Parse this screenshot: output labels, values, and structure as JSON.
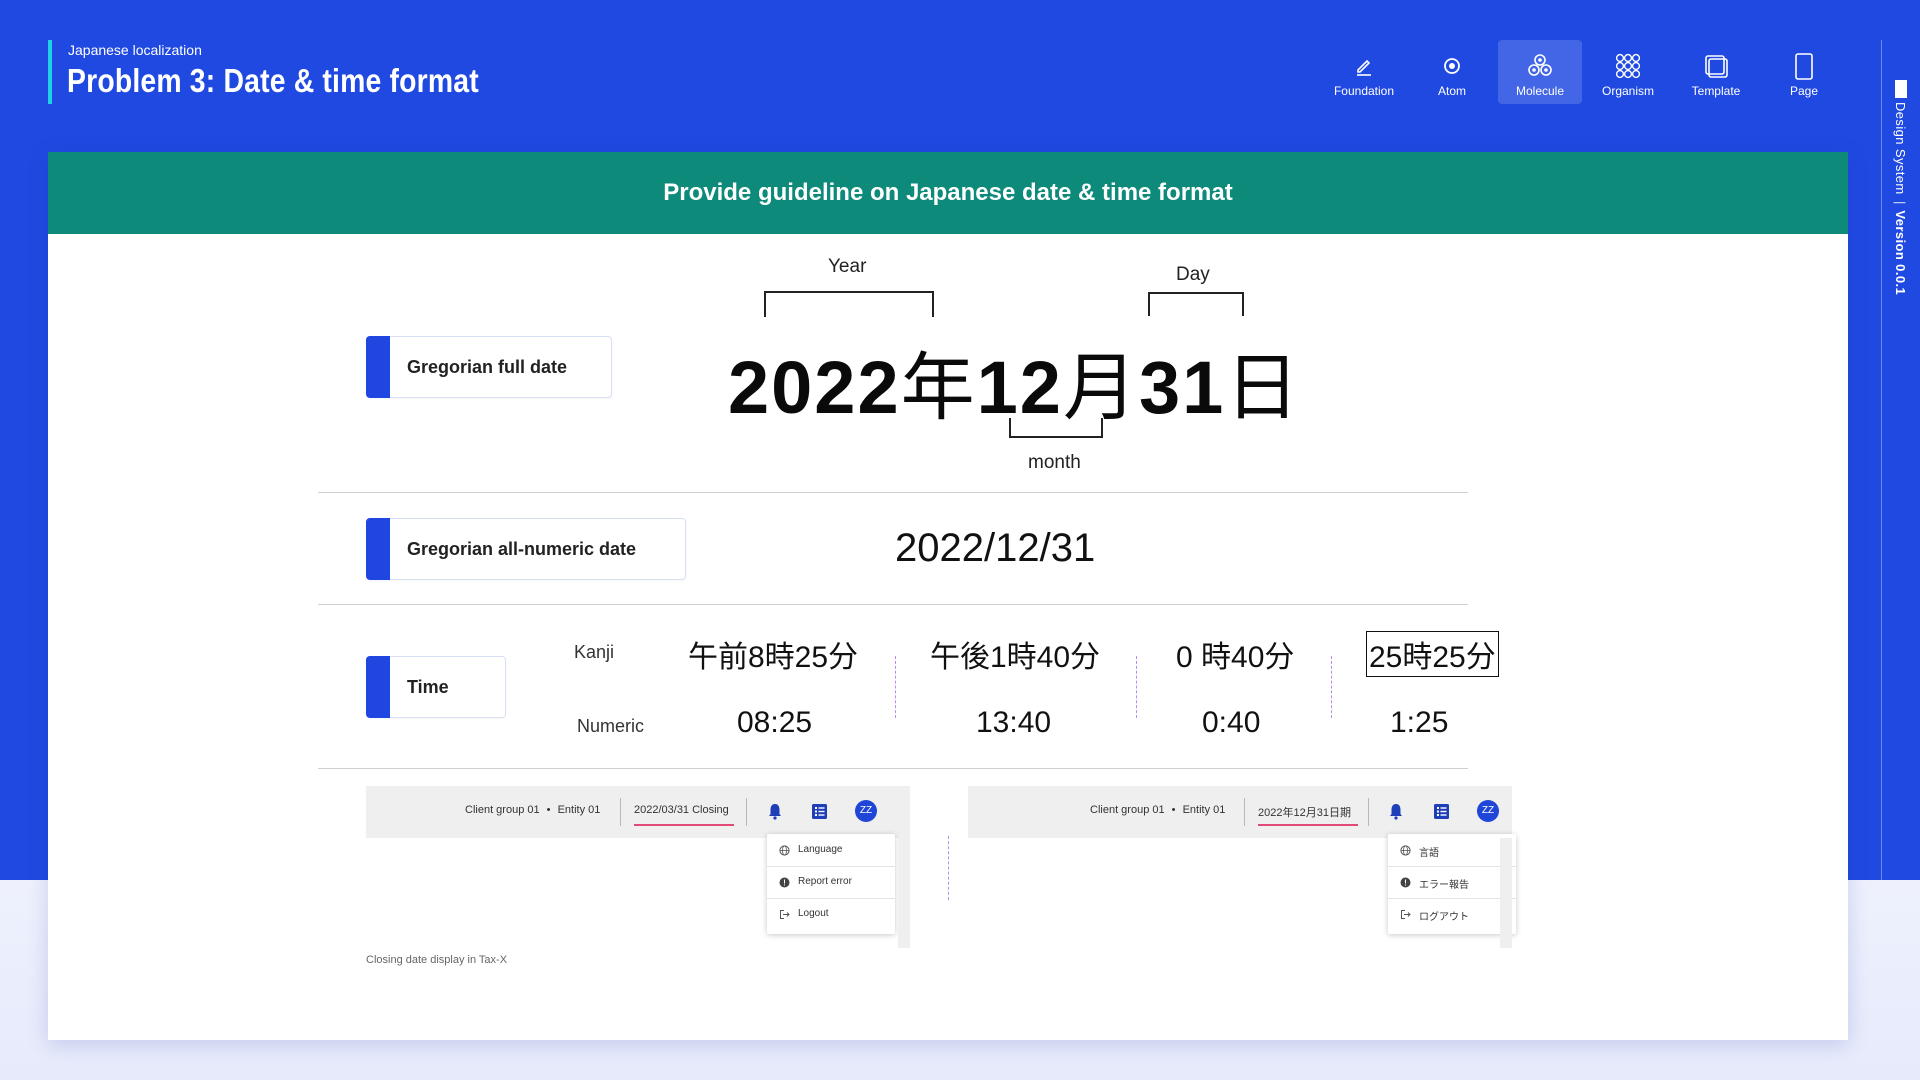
{
  "header": {
    "subtitle": "Japanese localization",
    "title": "Problem 3: Date & time format"
  },
  "nav": [
    {
      "label": "Foundation",
      "icon": "pencil-icon",
      "active": false
    },
    {
      "label": "Atom",
      "icon": "atom-icon",
      "active": false
    },
    {
      "label": "Molecule",
      "icon": "molecule-icon",
      "active": true
    },
    {
      "label": "Organism",
      "icon": "organism-icon",
      "active": false
    },
    {
      "label": "Template",
      "icon": "template-icon",
      "active": false
    },
    {
      "label": "Page",
      "icon": "page-icon",
      "active": false
    }
  ],
  "side": {
    "label": "Design System",
    "version": "Version 0.0.1"
  },
  "card": {
    "heading": "Provide guideline on Japanese date & time format"
  },
  "full_date": {
    "label": "Gregorian full date",
    "year": "2022",
    "year_kanji": "年",
    "month": "12",
    "month_kanji": "月",
    "day": "31",
    "day_kanji": "日",
    "year_label": "Year",
    "day_label": "Day",
    "month_label": "month"
  },
  "numeric_date": {
    "label": "Gregorian all-numeric date",
    "value": "2022/12/31"
  },
  "time": {
    "label": "Time",
    "kanji_label": "Kanji",
    "numeric_label": "Numeric",
    "kanji": [
      "午前8時25分",
      "午後1時40分",
      "0 時40分",
      "25時25分"
    ],
    "numeric": [
      "08:25",
      "13:40",
      "0:40",
      "1:25"
    ]
  },
  "mock_en": {
    "client": "Client group 01",
    "dot": "•",
    "entity": "Entity 01",
    "closing": "2022/03/31 Closing",
    "avatar": "ZZ",
    "menu": [
      "Language",
      "Report error",
      "Logout"
    ]
  },
  "mock_ja": {
    "client": "Client group 01",
    "dot": "•",
    "entity": "Entity 01",
    "closing": "2022年12月31日期",
    "avatar": "ZZ",
    "menu": [
      "言語",
      "エラー報告",
      "ログアウト"
    ]
  },
  "caption": "Closing date display in Tax-X",
  "colors": {
    "brand_blue": "#2049e2",
    "header_green": "#0d8a79",
    "accent_cyan": "#1fd1e6",
    "tab_blue": "#1f46e0",
    "underline_pink": "#e14b78",
    "dash_purple": "#b68cf0"
  }
}
